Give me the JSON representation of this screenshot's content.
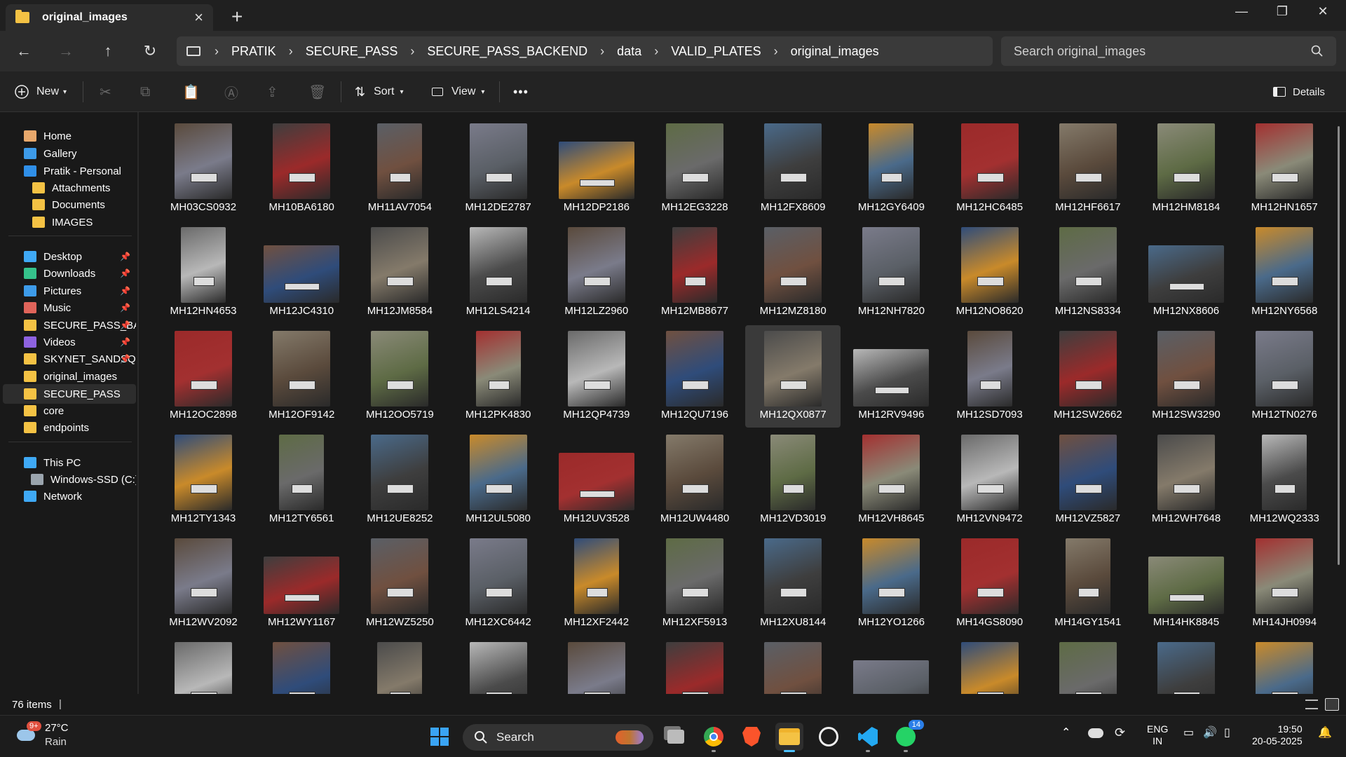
{
  "window": {
    "tab_title": "original_images",
    "controls": {
      "minimize": "—",
      "maximize": "❐",
      "close": "✕"
    }
  },
  "address": {
    "breadcrumbs": [
      "PRATIK",
      "SECURE_PASS",
      "SECURE_PASS_BACKEND",
      "data",
      "VALID_PLATES",
      "original_images"
    ],
    "search_placeholder": "Search original_images"
  },
  "commandbar": {
    "new_label": "New",
    "sort_label": "Sort",
    "view_label": "View",
    "more_label": "•••",
    "details_label": "Details"
  },
  "sidebar": {
    "items": [
      {
        "label": "Home",
        "icon": "home-icon",
        "color": "#e8a86c",
        "pinned": false,
        "selected": false
      },
      {
        "label": "Gallery",
        "icon": "gallery-icon",
        "color": "#3d9be9",
        "pinned": false,
        "selected": false
      },
      {
        "label": "Pratik - Personal",
        "icon": "onedrive-icon",
        "color": "#2f8fe8",
        "pinned": false,
        "selected": false
      },
      {
        "label": "Attachments",
        "icon": "folder-icon",
        "color": "#f4c244",
        "pinned": false,
        "selected": false
      },
      {
        "label": "Documents",
        "icon": "folder-icon",
        "color": "#f4c244",
        "pinned": false,
        "selected": false
      },
      {
        "label": "IMAGES",
        "icon": "folder-icon",
        "color": "#f4c244",
        "pinned": false,
        "selected": false
      },
      {
        "label": "Desktop",
        "icon": "desktop-icon",
        "color": "#3fa9f5",
        "pinned": true,
        "selected": false
      },
      {
        "label": "Downloads",
        "icon": "download-icon",
        "color": "#35c28b",
        "pinned": true,
        "selected": false
      },
      {
        "label": "Pictures",
        "icon": "pictures-icon",
        "color": "#3d9be9",
        "pinned": true,
        "selected": false
      },
      {
        "label": "Music",
        "icon": "music-icon",
        "color": "#e0645a",
        "pinned": true,
        "selected": false
      },
      {
        "label": "SECURE_PASS_BA",
        "icon": "folder-icon",
        "color": "#f4c244",
        "pinned": true,
        "selected": false
      },
      {
        "label": "Videos",
        "icon": "videos-icon",
        "color": "#8e63e0",
        "pinned": true,
        "selected": false
      },
      {
        "label": "SKYNET_SANDSQ",
        "icon": "folder-icon",
        "color": "#f4c244",
        "pinned": true,
        "selected": false
      },
      {
        "label": "original_images",
        "icon": "folder-icon",
        "color": "#f4c244",
        "pinned": false,
        "selected": false
      },
      {
        "label": "SECURE_PASS",
        "icon": "folder-icon",
        "color": "#f4c244",
        "pinned": false,
        "selected": true
      },
      {
        "label": "core",
        "icon": "folder-icon",
        "color": "#f4c244",
        "pinned": false,
        "selected": false
      },
      {
        "label": "endpoints",
        "icon": "folder-icon",
        "color": "#f4c244",
        "pinned": false,
        "selected": false
      },
      {
        "label": "This PC",
        "icon": "pc-icon",
        "color": "#3fa9f5",
        "pinned": false,
        "selected": false
      },
      {
        "label": "Windows-SSD (C:)",
        "icon": "drive-icon",
        "color": "#9aa4ad",
        "pinned": false,
        "selected": false
      },
      {
        "label": "Network",
        "icon": "network-icon",
        "color": "#3fa9f5",
        "pinned": false,
        "selected": false
      }
    ]
  },
  "files": [
    "MH03CS0932",
    "MH10BA6180",
    "MH11AV7054",
    "MH12DE2787",
    "MH12DP2186",
    "MH12EG3228",
    "MH12FX8609",
    "MH12GY6409",
    "MH12HC6485",
    "MH12HF6617",
    "MH12HM8184",
    "MH12HN1657",
    "MH12HN4653",
    "MH12JC4310",
    "MH12JM8584",
    "MH12LS4214",
    "MH12LZ2960",
    "MH12MB8677",
    "MH12MZ8180",
    "MH12NH7820",
    "MH12NO8620",
    "MH12NS8334",
    "MH12NX8606",
    "MH12NY6568",
    "MH12OC2898",
    "MH12OF9142",
    "MH12OO5719",
    "MH12PK4830",
    "MH12QP4739",
    "MH12QU7196",
    "MH12QX0877",
    "MH12RV9496",
    "MH12SD7093",
    "MH12SW2662",
    "MH12SW3290",
    "MH12TN0276",
    "MH12TY1343",
    "MH12TY6561",
    "MH12UE8252",
    "MH12UL5080",
    "MH12UV3528",
    "MH12UW4480",
    "MH12VD3019",
    "MH12VH8645",
    "MH12VN9472",
    "MH12VZ5827",
    "MH12WH7648",
    "MH12WQ2333",
    "MH12WV2092",
    "MH12WY1167",
    "MH12WZ5250",
    "MH12XC6442",
    "MH12XF2442",
    "MH12XF5913",
    "MH12XU8144",
    "MH12YO1266",
    "MH14GS8090",
    "MH14GY1541",
    "MH14HK8845",
    "MH14JH0994",
    "",
    "",
    "",
    "",
    "",
    "",
    "",
    "",
    "",
    "",
    "",
    ""
  ],
  "selected_file": "MH12QX0877",
  "status": {
    "item_count": "76 items",
    "separator": "|"
  },
  "taskbar": {
    "weather_temp": "27°C",
    "weather_desc": "Rain",
    "weather_badge": "9+",
    "search_label": "Search",
    "whatsapp_badge": "14",
    "lang_primary": "ENG",
    "lang_secondary": "IN",
    "time": "19:50",
    "date": "20-05-2025"
  }
}
